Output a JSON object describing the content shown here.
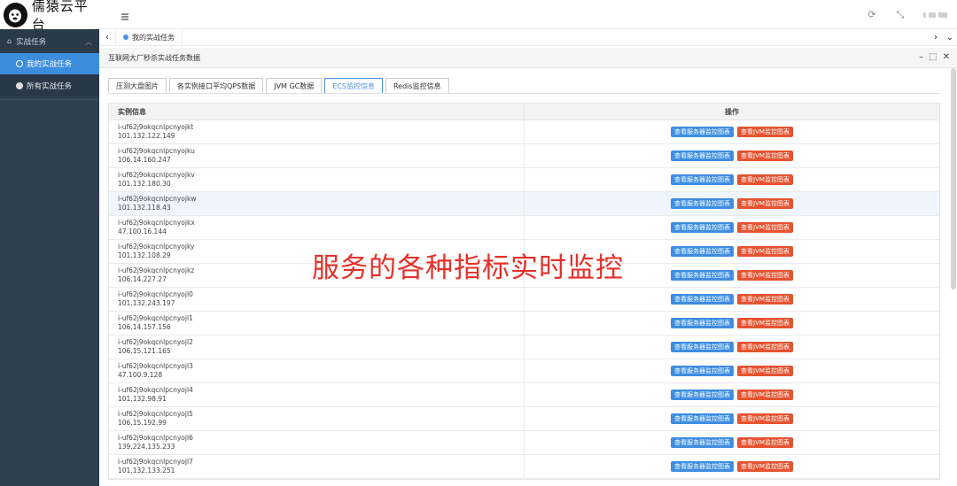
{
  "app": {
    "title": "儒猿云平台"
  },
  "header": {
    "icons": [
      "refresh-icon",
      "fullscreen-icon"
    ]
  },
  "sidebar": {
    "group_label": "实战任务",
    "items": [
      {
        "label": "我的实战任务",
        "active": true
      },
      {
        "label": "所有实战任务",
        "active": false
      }
    ]
  },
  "page_tabs": {
    "items": [
      {
        "label": "我的实战任务"
      }
    ]
  },
  "panel": {
    "title": "互联网大厂秒杀实战任务数据"
  },
  "subtabs": {
    "items": [
      {
        "label": "压测大盘图片"
      },
      {
        "label": "各实例接口平均QPS数据"
      },
      {
        "label": "JVM GC数据"
      },
      {
        "label": "ECS监控信息",
        "active": true
      },
      {
        "label": "Redis监控信息"
      }
    ]
  },
  "table": {
    "columns": [
      "实例信息",
      "操作"
    ],
    "button_server": "查看服务器监控图表",
    "button_jvm": "查看JVM监控图表",
    "rows": [
      {
        "id": "i-uf62j9okqcnlpcnyojkt",
        "ip": "101.132.122.149"
      },
      {
        "id": "i-uf62j9okqcnlpcnyojku",
        "ip": "106.14.160.247"
      },
      {
        "id": "i-uf62j9okqcnlpcnyojkv",
        "ip": "101.132.180.30"
      },
      {
        "id": "i-uf62j9okqcnlpcnyojkw",
        "ip": "101.132.118.43"
      },
      {
        "id": "i-uf62j9okqcnlpcnyojkx",
        "ip": "47.100.16.144"
      },
      {
        "id": "i-uf62j9okqcnlpcnyojky",
        "ip": "101.132.108.29"
      },
      {
        "id": "i-uf62j9okqcnlpcnyojkz",
        "ip": "106.14.227.27"
      },
      {
        "id": "i-uf62j9okqcnlpcnyojl0",
        "ip": "101.132.243.197"
      },
      {
        "id": "i-uf62j9okqcnlpcnyojl1",
        "ip": "106.14.157.156"
      },
      {
        "id": "i-uf62j9okqcnlpcnyojl2",
        "ip": "106.15.121.165"
      },
      {
        "id": "i-uf62j9okqcnlpcnyojl3",
        "ip": "47.100.9.128"
      },
      {
        "id": "i-uf62j9okqcnlpcnyojl4",
        "ip": "101.132.98.91"
      },
      {
        "id": "i-uf62j9okqcnlpcnyojl5",
        "ip": "106.15.192.99"
      },
      {
        "id": "i-uf62j9okqcnlpcnyojl6",
        "ip": "139.224.135.233"
      },
      {
        "id": "i-uf62j9okqcnlpcnyojl7",
        "ip": "101.132.133.251"
      }
    ]
  },
  "overlay_caption": "服务的各种指标实时监控",
  "colors": {
    "sidebar_bg": "#2f4050",
    "active_blue": "#3c8dde",
    "btn_blue": "#3e8de0",
    "btn_red": "#e5532f",
    "caption_red": "#e5302a"
  }
}
